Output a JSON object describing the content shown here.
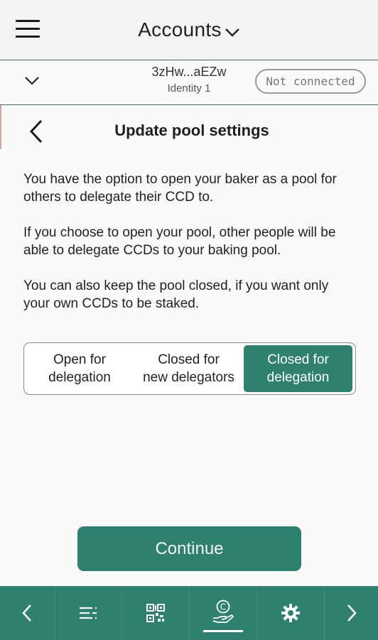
{
  "header": {
    "title": "Accounts",
    "menu_icon": "hamburger-menu-icon",
    "dropdown_icon": "chevron-down-icon"
  },
  "account": {
    "address": "3zHw...aEZw",
    "identity": "Identity 1",
    "connection_status": "Not connected",
    "expand_icon": "chevron-down-icon"
  },
  "page": {
    "title": "Update pool settings",
    "back_icon": "chevron-left-icon",
    "paragraphs": [
      "You have the option to open your baker as a pool for others to delegate their CCD to.",
      "If you choose to open your pool, other people will be able to delegate CCDs to your baking pool.",
      "You can also keep the pool closed, if you want only your own CCDs to be staked."
    ]
  },
  "pool_options": {
    "selected": "Closed for delegation",
    "options": [
      {
        "line1": "Open for",
        "line2": "delegation"
      },
      {
        "line1": "Closed for",
        "line2": "new delegators"
      },
      {
        "line1": "Closed for",
        "line2": "delegation"
      }
    ]
  },
  "actions": {
    "continue_label": "Continue"
  },
  "bottom_nav": {
    "active_index": 3,
    "items": [
      {
        "icon": "chevron-left-icon"
      },
      {
        "icon": "list-icon"
      },
      {
        "icon": "qr-code-icon"
      },
      {
        "icon": "staking-ccd-icon"
      },
      {
        "icon": "gear-icon"
      },
      {
        "icon": "chevron-right-icon"
      }
    ]
  },
  "colors": {
    "accent": "#2e8070",
    "divider": "#3f6c6b",
    "badge_border": "#9a9a9a"
  }
}
